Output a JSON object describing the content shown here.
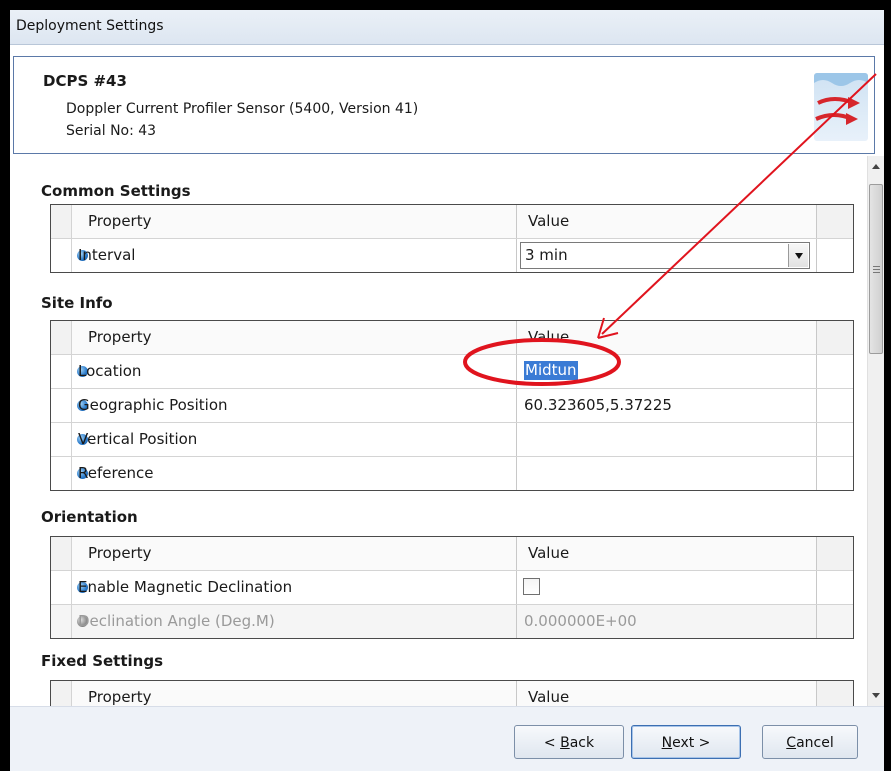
{
  "window": {
    "title": "Deployment Settings"
  },
  "device": {
    "name": "DCPS #43",
    "description": "Doppler Current Profiler Sensor (5400, Version 41)",
    "serial": "Serial No: 43",
    "logo_icon": "sensor-waves-icon"
  },
  "columns": {
    "property": "Property",
    "value": "Value"
  },
  "sections": {
    "common": {
      "title": "Common Settings",
      "rows": [
        {
          "label": "Interval",
          "value": "3 min"
        }
      ]
    },
    "site": {
      "title": "Site Info",
      "rows": [
        {
          "label": "Location",
          "value": "Midtun"
        },
        {
          "label": "Geographic Position",
          "value": "60.323605,5.37225"
        },
        {
          "label": "Vertical Position",
          "value": ""
        },
        {
          "label": "Reference",
          "value": ""
        }
      ]
    },
    "orientation": {
      "title": "Orientation",
      "rows": [
        {
          "label": "Enable Magnetic Declination",
          "checked": false
        },
        {
          "label": "Declination Angle (Deg.M)",
          "value": "0.000000E+00",
          "disabled": true
        }
      ]
    },
    "fixed": {
      "title": "Fixed Settings"
    }
  },
  "buttons": {
    "back": {
      "prefix": "< ",
      "mnemonic": "B",
      "rest": "ack"
    },
    "next": {
      "mnemonic": "N",
      "rest": "ext >"
    },
    "cancel": {
      "mnemonic": "C",
      "rest": "ancel"
    }
  },
  "colors": {
    "annotation": "#e0141e",
    "selection": "#3a7bd5",
    "accent": "#5b79a8"
  }
}
